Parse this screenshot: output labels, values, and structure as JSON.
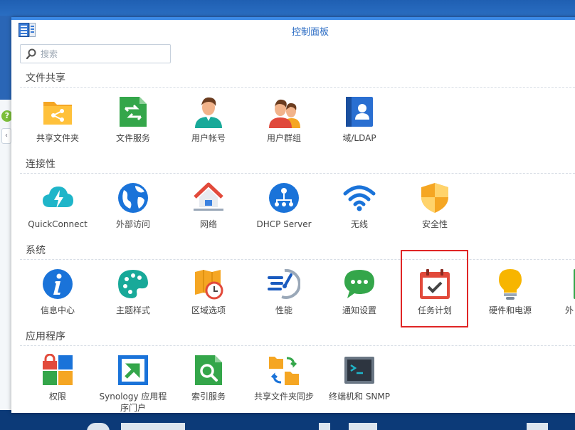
{
  "window": {
    "title": "控制面板"
  },
  "search": {
    "placeholder": "搜索",
    "value": ""
  },
  "sections": [
    {
      "title": "文件共享",
      "items": [
        {
          "label": "共享文件夹",
          "icon": "shared-folder-icon"
        },
        {
          "label": "文件服务",
          "icon": "file-services-icon"
        },
        {
          "label": "用户帐号",
          "icon": "user-icon"
        },
        {
          "label": "用户群组",
          "icon": "group-icon"
        },
        {
          "label": "域/LDAP",
          "icon": "domain-ldap-icon"
        }
      ]
    },
    {
      "title": "连接性",
      "items": [
        {
          "label": "QuickConnect",
          "icon": "quickconnect-icon"
        },
        {
          "label": "外部访问",
          "icon": "external-access-icon"
        },
        {
          "label": "网络",
          "icon": "network-icon"
        },
        {
          "label": "DHCP Server",
          "icon": "dhcp-server-icon"
        },
        {
          "label": "无线",
          "icon": "wireless-icon"
        },
        {
          "label": "安全性",
          "icon": "security-icon"
        }
      ]
    },
    {
      "title": "系统",
      "items": [
        {
          "label": "信息中心",
          "icon": "info-center-icon"
        },
        {
          "label": "主题样式",
          "icon": "theme-icon"
        },
        {
          "label": "区域选项",
          "icon": "regional-options-icon"
        },
        {
          "label": "性能",
          "icon": "performance-icon"
        },
        {
          "label": "通知设置",
          "icon": "notification-icon"
        },
        {
          "label": "任务计划",
          "icon": "task-scheduler-icon"
        },
        {
          "label": "硬件和电源",
          "icon": "hardware-power-icon"
        },
        {
          "label": "外",
          "icon": "external-devices-icon"
        }
      ]
    },
    {
      "title": "应用程序",
      "items": [
        {
          "label": "权限",
          "icon": "privileges-icon"
        },
        {
          "label": "Synology 应用程序门户",
          "icon": "application-portal-icon"
        },
        {
          "label": "索引服务",
          "icon": "indexing-service-icon"
        },
        {
          "label": "共享文件夹同步",
          "icon": "shared-folder-sync-icon"
        },
        {
          "label": "终端机和 SNMP",
          "icon": "terminal-snmp-icon"
        }
      ]
    }
  ],
  "highlighted_item": "任务计划",
  "colors": {
    "accent": "#3c8ae6",
    "highlight_border": "#e02525",
    "desktop": "#2a66b6"
  }
}
